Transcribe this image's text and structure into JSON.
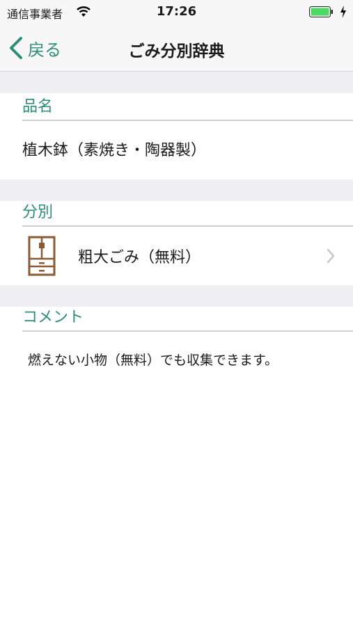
{
  "status_bar": {
    "carrier": "通信事業者",
    "time": "17:26"
  },
  "nav": {
    "back_label": "戻る",
    "title": "ごみ分別辞典"
  },
  "sections": {
    "item_name": {
      "header": "品名",
      "value": "植木鉢（素焼き・陶器製）"
    },
    "category": {
      "header": "分別",
      "value": "粗大ごみ（無料）"
    },
    "comment": {
      "header": "コメント",
      "value": "燃えない小物（無料）でも収集できます。"
    }
  },
  "colors": {
    "accent": "#2a8f73",
    "separator": "#efeff4",
    "cabinet": "#8a5a33",
    "battery": "#4cd964"
  },
  "icons": {
    "back": "chevron-left-icon",
    "wifi": "wifi-icon",
    "battery": "battery-icon",
    "cabinet": "cabinet-icon",
    "disclosure": "chevron-right-icon"
  }
}
